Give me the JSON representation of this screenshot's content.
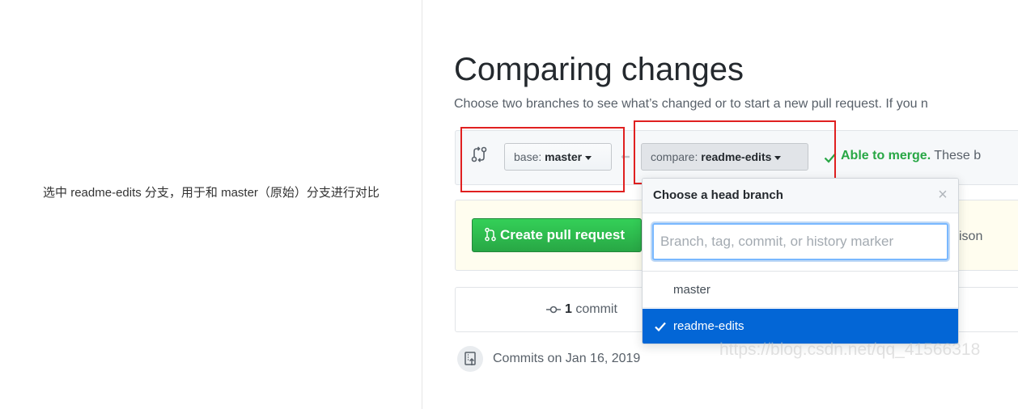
{
  "annotation": {
    "caption": "选中 readme-edits 分支，用于和 master（原始）分支进行对比"
  },
  "page": {
    "title": "Comparing changes",
    "subtitle": "Choose two branches to see what’s changed or to start a new pull request. If you n"
  },
  "range": {
    "base_label": "base: ",
    "base_value": "master",
    "compare_label": "compare: ",
    "compare_value": "readme-edits",
    "merge_status": "Able to merge.",
    "merge_rest": " These b"
  },
  "create": {
    "button_label": "Create pull request",
    "side_text": "ison"
  },
  "stats": {
    "commit_count": "1",
    "commit_label": " commit"
  },
  "commits": {
    "heading": "Commits on Jan 16, 2019"
  },
  "dropdown": {
    "title": "Choose a head branch",
    "close": "×",
    "filter_placeholder": "Branch, tag, commit, or history marker",
    "filter_value": "",
    "items": [
      {
        "label": "master",
        "selected": false
      },
      {
        "label": "readme-edits",
        "selected": true
      }
    ]
  },
  "watermark": "https://blog.csdn.net/qq_41566318",
  "colors": {
    "highlight_box": "#e02020",
    "merge_green": "#28a745",
    "selected_blue": "#0366d6",
    "create_button": "#28a745"
  }
}
